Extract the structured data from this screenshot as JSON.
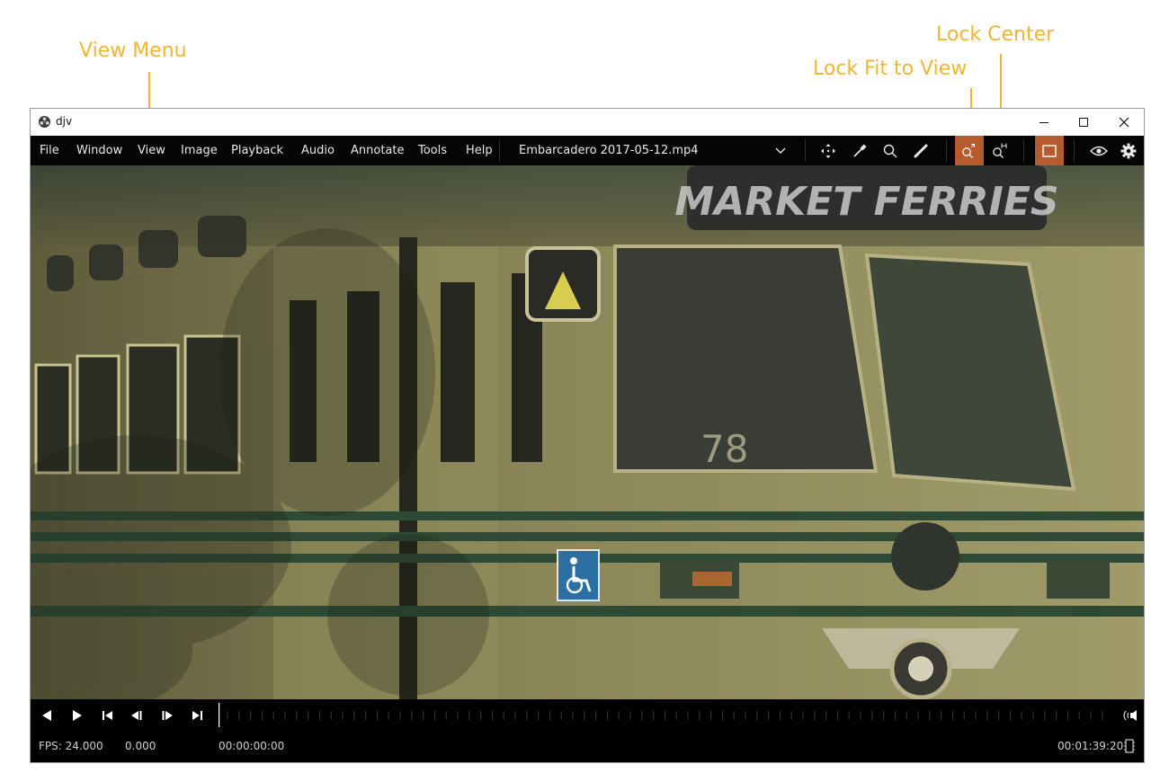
{
  "callouts": {
    "view_menu": "View Menu",
    "lock_fit": "Lock Fit to View",
    "lock_center": "Lock Center"
  },
  "colors": {
    "callout": "#f2b52f",
    "active_tool": "#b65a2f",
    "menubar": "#050505"
  },
  "window": {
    "title": "djv",
    "icon": "djv-app-icon",
    "controls": [
      "minimize-icon",
      "maximize-icon",
      "close-icon"
    ]
  },
  "menu": {
    "items": [
      "File",
      "Window",
      "View",
      "Image",
      "Playback",
      "Audio",
      "Annotate",
      "Tools",
      "Help"
    ]
  },
  "file": {
    "current": "Embarcadero 2017-05-12.mp4",
    "dropdown_icon": "chevron-down-icon"
  },
  "toolbar": {
    "tools": [
      "pan-tool-icon",
      "color-picker-icon",
      "magnify-icon",
      "annotate-pen-icon"
    ],
    "lock_fit_active": true,
    "lock_center_active": false,
    "frame_view_active": true,
    "extra": [
      "eye-icon",
      "settings-gear-icon"
    ]
  },
  "viewport": {
    "content": "Yellow streetcar image",
    "sign_text": "MARKET FERRIES",
    "car_number": "78"
  },
  "playback": {
    "buttons": [
      "play-reverse-icon",
      "play-forward-icon",
      "go-to-start-icon",
      "step-back-icon",
      "step-forward-icon",
      "go-to-end-icon"
    ],
    "audio_icon": "audio-sync-icon"
  },
  "status": {
    "fps": "FPS: 24.000",
    "speed": "0.000",
    "current_time": "00:00:00:00",
    "duration": "00:01:39:20",
    "frame_icon": "film-frame-icon"
  }
}
